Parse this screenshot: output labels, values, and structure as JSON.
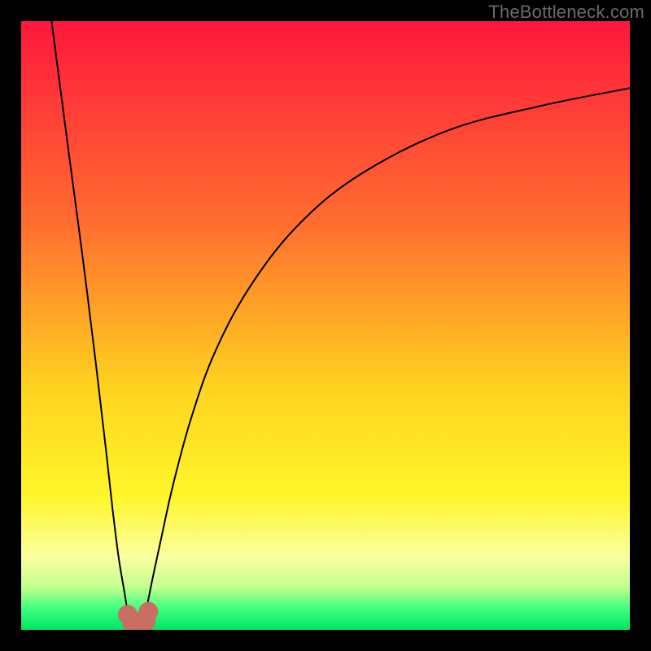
{
  "watermark": "TheBottleneck.com",
  "chart_data": {
    "type": "line",
    "title": "",
    "xlabel": "",
    "ylabel": "",
    "xlim": [
      0,
      100
    ],
    "ylim": [
      0,
      100
    ],
    "background_gradient_stops": [
      {
        "offset": 0.0,
        "color": "#ff173d"
      },
      {
        "offset": 0.33,
        "color": "#ff6d2f"
      },
      {
        "offset": 0.6,
        "color": "#ffd21f"
      },
      {
        "offset": 0.78,
        "color": "#fff62a"
      },
      {
        "offset": 0.88,
        "color": "#fbffa0"
      },
      {
        "offset": 0.93,
        "color": "#c4ff8f"
      },
      {
        "offset": 0.965,
        "color": "#3dff7f"
      },
      {
        "offset": 1.0,
        "color": "#00e565"
      }
    ],
    "series": [
      {
        "name": "left-branch",
        "x": [
          5,
          8,
          10,
          12,
          14,
          15,
          16,
          17,
          17.5,
          18
        ],
        "y": [
          100,
          77,
          62,
          46,
          29,
          20,
          12,
          6,
          3,
          1
        ]
      },
      {
        "name": "right-branch",
        "x": [
          20,
          20.5,
          21.5,
          23,
          25,
          28,
          32,
          38,
          46,
          56,
          70,
          85,
          100
        ],
        "y": [
          1,
          3,
          8,
          15,
          24,
          35,
          46,
          57,
          67,
          75,
          82,
          86,
          89
        ]
      }
    ],
    "markers": [
      {
        "x": 17.5,
        "y": 2.5,
        "r": 1.6
      },
      {
        "x": 18.4,
        "y": 1.2,
        "r": 1.8
      },
      {
        "x": 19.4,
        "y": 1.0,
        "r": 1.9
      },
      {
        "x": 20.3,
        "y": 1.5,
        "r": 1.8
      },
      {
        "x": 20.9,
        "y": 3.0,
        "r": 1.6
      }
    ],
    "marker_color": "#c86e62",
    "curve_color": "#000000",
    "curve_width": 2
  }
}
